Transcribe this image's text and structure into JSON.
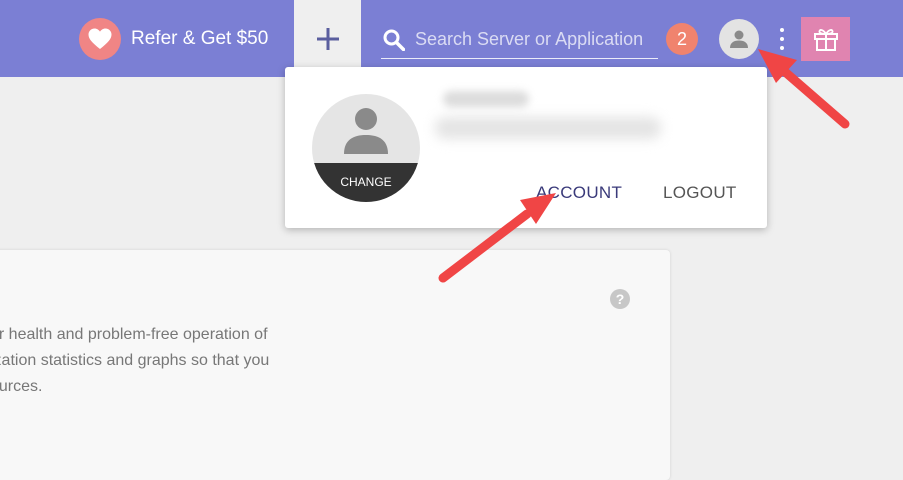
{
  "topbar": {
    "refer_label": "Refer & Get $50",
    "search_placeholder": "Search Server or Application",
    "notification_count": "2"
  },
  "icons": {
    "refer": "heart-icon",
    "add": "plus-icon",
    "search": "search-icon",
    "user": "user-icon",
    "menu": "kebab-menu-icon",
    "gift": "gift-icon",
    "help": "help-icon"
  },
  "dropdown": {
    "change_label": "CHANGE",
    "account_label": "ACCOUNT",
    "logout_label": "LOGOUT"
  },
  "card": {
    "help_glyph": "?",
    "lines": [
      "er health and problem-free operation of",
      "ization statistics and graphs so that you",
      "ources."
    ]
  },
  "colors": {
    "topbar": "#7b7fd4",
    "heart_circle": "#f08585",
    "notification_badge": "#f0836e",
    "gift_button": "#e084b0",
    "annotation_arrow": "#f04545"
  }
}
